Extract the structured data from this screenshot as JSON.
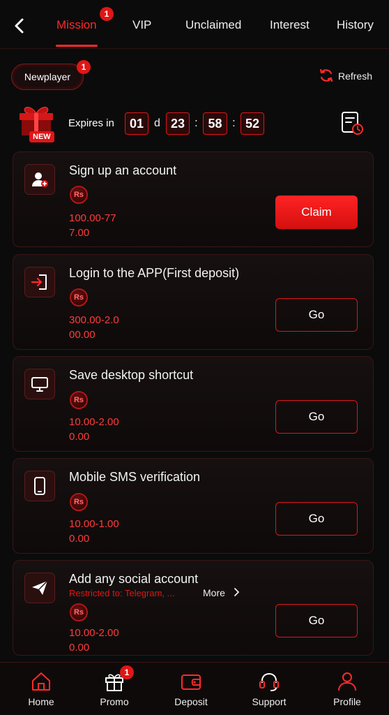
{
  "tabs": [
    {
      "label": "Mission",
      "badge": "1"
    },
    {
      "label": "VIP"
    },
    {
      "label": "Unclaimed"
    },
    {
      "label": "Interest"
    },
    {
      "label": "History"
    }
  ],
  "filter": {
    "label": "Newplayer",
    "badge": "1"
  },
  "refresh_label": "Refresh",
  "gift_badge": "NEW",
  "expires": {
    "label": "Expires in",
    "days": "01",
    "days_unit": "d",
    "hours": "23",
    "minutes": "58",
    "seconds": "52",
    "separator": ":"
  },
  "currency_symbol": "Rs",
  "missions": [
    {
      "title": "Sign up an account",
      "reward_line1": "100.00-77",
      "reward_line2": "7.00",
      "action": "Claim",
      "icon": "user-add-icon"
    },
    {
      "title": "Login to the APP(First deposit)",
      "reward_line1": "300.00-2.0",
      "reward_line2": "00.00",
      "action": "Go",
      "icon": "login-icon"
    },
    {
      "title": "Save desktop shortcut",
      "reward_line1": "10.00-2.00",
      "reward_line2": "0.00",
      "action": "Go",
      "icon": "monitor-icon"
    },
    {
      "title": "Mobile SMS verification",
      "reward_line1": "10.00-1.00",
      "reward_line2": "0.00",
      "action": "Go",
      "icon": "mobile-icon"
    },
    {
      "title": "Add any social account",
      "restricted": "Restricted to: Telegram, ...",
      "more": "More",
      "reward_line1": "10.00-2.00",
      "reward_line2": "0.00",
      "action": "Go",
      "icon": "send-icon"
    }
  ],
  "nav": [
    {
      "label": "Home",
      "icon": "home-icon"
    },
    {
      "label": "Promo",
      "icon": "gift-icon",
      "badge": "1"
    },
    {
      "label": "Deposit",
      "icon": "wallet-icon"
    },
    {
      "label": "Support",
      "icon": "headset-icon"
    },
    {
      "label": "Profile",
      "icon": "person-icon"
    }
  ],
  "colors": {
    "accent": "#ff2a2a",
    "background": "#0b0b0b",
    "reward_text": "#ff3b3b"
  }
}
